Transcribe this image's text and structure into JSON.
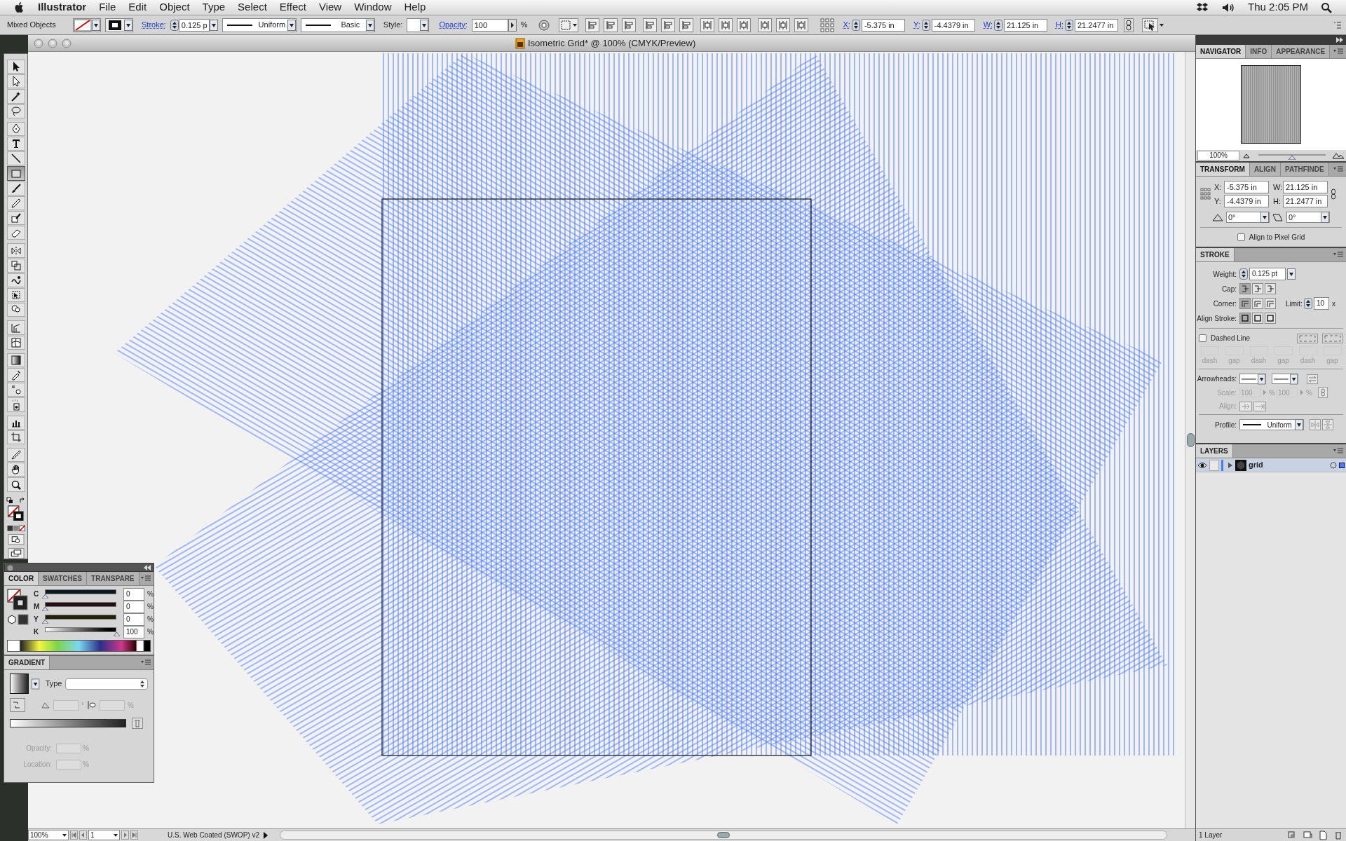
{
  "menu_bar": {
    "app": "Illustrator",
    "menus": [
      "File",
      "Edit",
      "Object",
      "Type",
      "Select",
      "Effect",
      "View",
      "Window",
      "Help"
    ],
    "clock": "Thu 2:05 PM"
  },
  "control_bar": {
    "selection": "Mixed Objects",
    "stroke_label": "Stroke:",
    "stroke_weight": "0.125 p",
    "profile": "Uniform",
    "brush": "Basic",
    "style_label": "Style:",
    "opacity_label": "Opacity:",
    "opacity": "100",
    "opacity_unit": "%",
    "fields": [
      {
        "label": "X:",
        "value": "-5.375 in"
      },
      {
        "label": "Y:",
        "value": "-4.4379 in"
      },
      {
        "label": "W:",
        "value": "21.125 in"
      },
      {
        "label": "H:",
        "value": "21.2477 in"
      }
    ]
  },
  "document": {
    "title": "Isometric Grid* @ 100% (CMYK/Preview)"
  },
  "tools": [
    {
      "selected": false
    },
    {
      "selected": false
    },
    {
      "selected": false
    },
    {
      "selected": false
    },
    {
      "selected": false
    },
    {
      "selected": false
    },
    {
      "selected": false
    },
    {
      "selected": true
    },
    {
      "selected": false
    },
    {
      "selected": false
    },
    {
      "selected": false
    },
    {
      "selected": false
    },
    {
      "selected": false
    },
    {
      "selected": false
    },
    {
      "selected": false
    },
    {
      "selected": false
    },
    {
      "selected": false
    },
    {
      "selected": false
    },
    {
      "selected": false
    },
    {
      "selected": false
    },
    {
      "selected": false
    },
    {
      "selected": false
    },
    {
      "selected": false
    },
    {
      "selected": false
    },
    {
      "selected": false
    },
    {
      "selected": false
    },
    {
      "selected": false
    },
    {
      "selected": false
    }
  ],
  "color_panel": {
    "tabs": [
      {
        "label": "COLOR",
        "selected": true
      },
      {
        "label": "SWATCHES",
        "selected": false
      },
      {
        "label": "TRANSPARE",
        "selected": false
      }
    ],
    "channels": [
      {
        "name": "C",
        "value": "0",
        "unit": "%",
        "level": 0
      },
      {
        "name": "M",
        "value": "0",
        "unit": "%",
        "level": 0
      },
      {
        "name": "Y",
        "value": "0",
        "unit": "%",
        "level": 0
      },
      {
        "name": "K",
        "value": "100",
        "unit": "%",
        "level": 1
      }
    ]
  },
  "gradient_panel": {
    "title": "GRADIENT",
    "type_label": "Type",
    "angle_unit": "°",
    "ratio_unit": "%",
    "opacity_label": "Opacity:",
    "opacity_unit": "%",
    "location_label": "Location:",
    "location_unit": "%"
  },
  "status_bar": {
    "zoom": "100%",
    "page": "1",
    "profile": "U.S. Web Coated (SWOP) v2"
  },
  "navigator": {
    "tabs": [
      {
        "label": "NAVIGATOR",
        "selected": true
      },
      {
        "label": "INFO",
        "selected": false
      },
      {
        "label": "APPEARANCE",
        "selected": false
      }
    ],
    "zoom": "100%",
    "level": 0.5
  },
  "transform": {
    "tabs": [
      {
        "label": "TRANSFORM",
        "selected": true
      },
      {
        "label": "ALIGN",
        "selected": false
      },
      {
        "label": "PATHFINDE",
        "selected": false
      }
    ],
    "fields": [
      {
        "label": "X:",
        "value": "-5.375 in"
      },
      {
        "label": "W:",
        "value": "21.125 in"
      },
      {
        "label": "Y:",
        "value": "-4.4379 in"
      },
      {
        "label": "H:",
        "value": "21.2477 in"
      }
    ],
    "rotate": "0°",
    "shear": "0°",
    "pixel_grid": {
      "label": "Align to Pixel Grid",
      "checked": false
    }
  },
  "stroke": {
    "title": "STROKE",
    "weight_label": "Weight:",
    "weight": "0.125 pt",
    "cap_label": "Cap:",
    "corner_label": "Corner:",
    "limit_label": "Limit:",
    "limit": "10",
    "limit_unit": "x",
    "align_label": "Align Stroke:",
    "dashed": {
      "label": "Dashed Line",
      "checked": false
    },
    "dash_labels": [
      "dash",
      "gap",
      "dash",
      "gap",
      "dash",
      "gap"
    ],
    "arrowheads_label": "Arrowheads:",
    "scale_label": "Scale:",
    "scales": [
      {
        "value": "100",
        "unit": "%",
        "disabled": true
      },
      {
        "value": "100",
        "unit": "%",
        "disabled": true
      }
    ],
    "align_arrow_label": "Align:",
    "profile_label": "Profile:",
    "profile": "Uniform"
  },
  "layers": {
    "title": "LAYERS",
    "items": [
      {
        "name": "grid",
        "visible": true,
        "selected": true,
        "expanded": false
      }
    ],
    "footer": "1 Layer"
  }
}
